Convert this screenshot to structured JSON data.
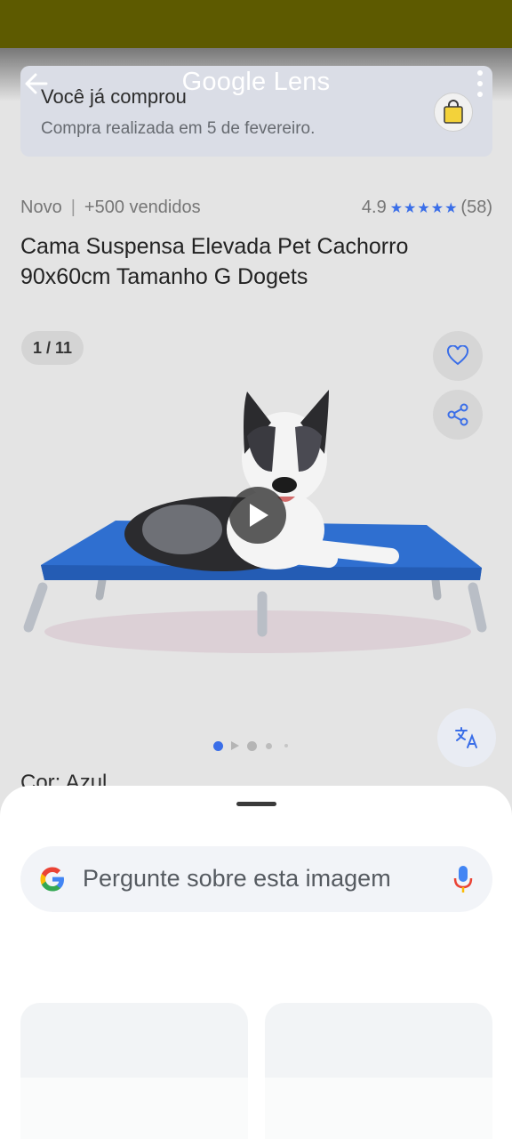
{
  "lens": {
    "title": "Google Lens"
  },
  "purchase": {
    "title": "Você já comprou",
    "subtitle": "Compra realizada em 5 de fevereiro."
  },
  "product": {
    "condition": "Novo",
    "sold": "+500 vendidos",
    "rating": "4.9",
    "rating_count": "(58)",
    "stars": 5,
    "title": "Cama Suspensa Elevada Pet Cachorro 90x60cm Tamanho G Dogets",
    "color_label": "Cor: Azul"
  },
  "gallery": {
    "counter": "1 / 11",
    "current_index": 1,
    "total": 11
  },
  "search": {
    "placeholder": "Pergunte sobre esta imagem"
  },
  "colors": {
    "status_bar": "#5d5a00",
    "accent_blue": "#3a6ee8",
    "bed_blue": "#2f6fd0"
  },
  "icons": [
    "back-arrow-icon",
    "more-vert-icon",
    "shopping-bag-icon",
    "heart-icon",
    "share-icon",
    "play-icon",
    "translate-icon",
    "google-g-icon",
    "mic-icon"
  ]
}
